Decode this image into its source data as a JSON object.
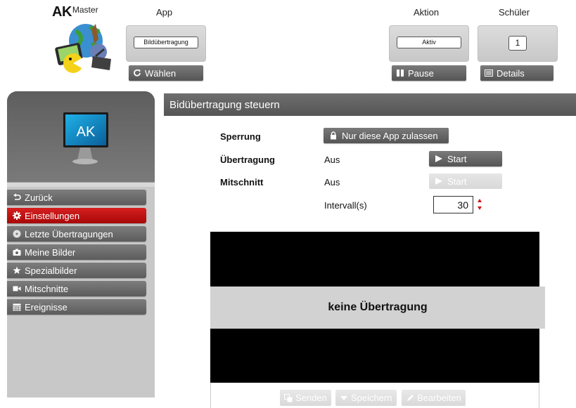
{
  "logo": {
    "brand": "AK",
    "suffix": "Master"
  },
  "header": {
    "app_label": "App",
    "action_label": "Aktion",
    "students_label": "Schüler",
    "app_value": "Bildübertragung",
    "choose_button": "Wählen",
    "action_value": "Aktiv",
    "pause_button": "Pause",
    "students_count": "1",
    "details_button": "Details"
  },
  "sidebar": {
    "monitor_text": "AK",
    "items": [
      {
        "label": "Zurück",
        "icon": "back-arrow-icon",
        "active": false
      },
      {
        "label": "Einstellungen",
        "icon": "gear-icon",
        "active": true
      },
      {
        "label": "Letzte Übertragungen",
        "icon": "disc-icon",
        "active": false
      },
      {
        "label": "Meine Bilder",
        "icon": "camera-icon",
        "active": false
      },
      {
        "label": "Spezialbilder",
        "icon": "star-icon",
        "active": false
      },
      {
        "label": "Mitschnitte",
        "icon": "video-camera-icon",
        "active": false
      },
      {
        "label": "Ereignisse",
        "icon": "calendar-icon",
        "active": false
      }
    ]
  },
  "main": {
    "title": "Bidübertragung steuern",
    "lock": {
      "label": "Sperrung",
      "button": "Nur diese App zulassen"
    },
    "transmission": {
      "label": "Übertragung",
      "status": "Aus",
      "button": "Start"
    },
    "recording": {
      "label": "Mitschnitt",
      "status": "Aus",
      "button": "Start"
    },
    "interval": {
      "label": "Intervall(s)",
      "value": "30"
    },
    "preview": {
      "message": "keine Übertragung"
    },
    "actions": {
      "send": "Senden",
      "save": "Speichern",
      "edit": "Bearbeiten"
    }
  },
  "colors": {
    "accent_red": "#c81414",
    "dark_button": "#5c5c5c",
    "header_bar": "#606060",
    "disabled_button": "#dedede"
  }
}
